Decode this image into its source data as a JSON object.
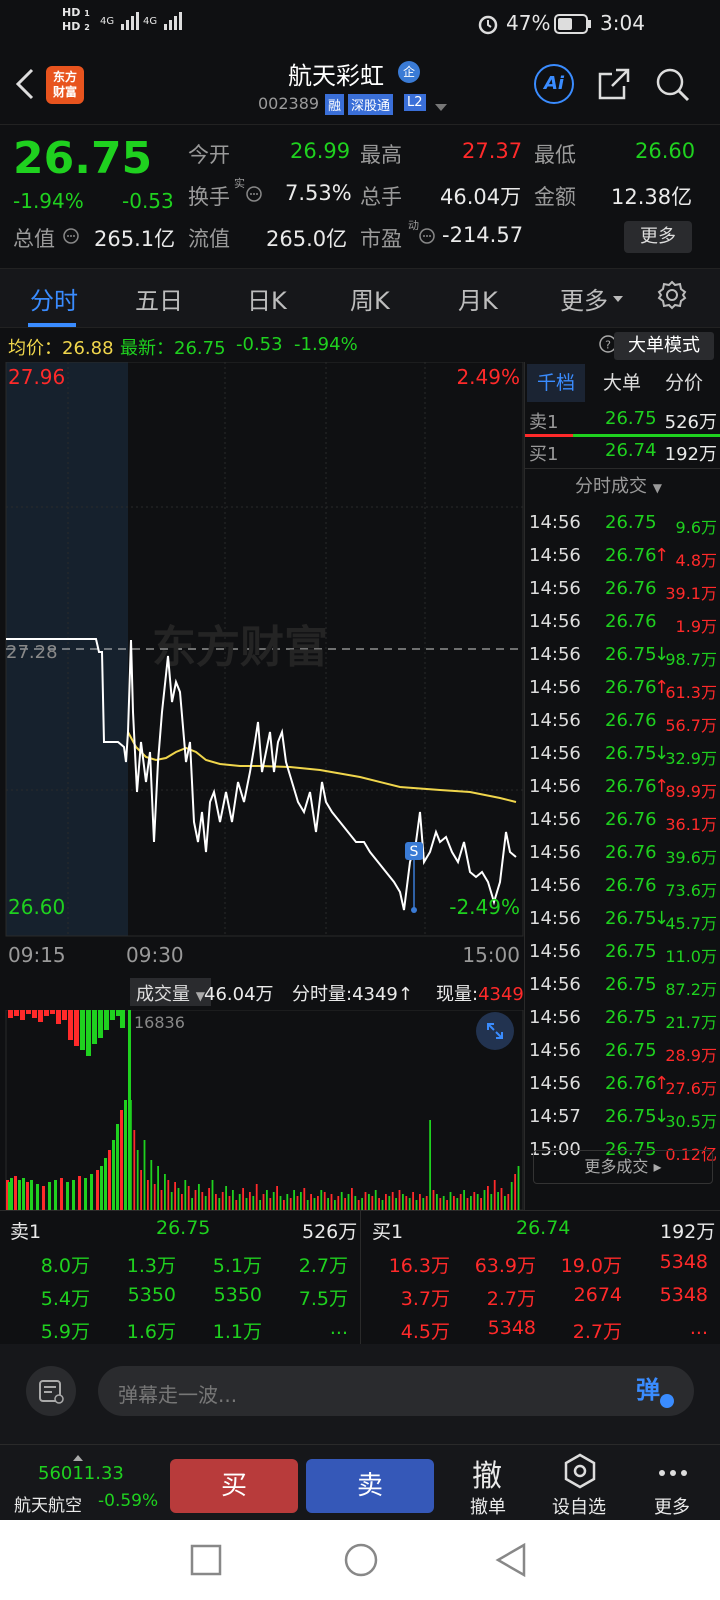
{
  "status_bar": {
    "hd1": "HD",
    "hd2": "HD",
    "net1": "4G",
    "net2": "4G",
    "battery": "47%",
    "time": "3:04"
  },
  "header": {
    "logo_text": "东方财富",
    "title": "航天彩虹",
    "badge_qi": "企",
    "code": "002389",
    "tag_rong": "融",
    "tag_market": "深股通",
    "tag_level": "L2",
    "ai_label": "Ai"
  },
  "quote": {
    "price": "26.75",
    "pct": "-1.94%",
    "chg": "-0.53",
    "open_label": "今开",
    "open": "26.99",
    "high_label": "最高",
    "high": "27.37",
    "low_label": "最低",
    "low": "26.60",
    "turnover_label": "换手",
    "turnover_sup": "实",
    "turnover": "7.53%",
    "volume_label": "总手",
    "volume": "46.04万",
    "amount_label": "金额",
    "amount": "12.38亿",
    "mcap_label": "总值",
    "mcap": "265.1亿",
    "float_label": "流值",
    "float": "265.0亿",
    "pe_label": "市盈",
    "pe_sup": "动",
    "pe": "-214.57",
    "more": "更多"
  },
  "tabs": [
    "分时",
    "五日",
    "日K",
    "周K",
    "月K",
    "更多"
  ],
  "info_line": {
    "avg_label": "均价：",
    "avg": "26.88",
    "latest_label": "最新：",
    "latest": "26.75",
    "chg": "-0.53",
    "pct": "-1.94%",
    "mode_button": "大单模式"
  },
  "chart": {
    "y_top": "27.96",
    "y_bottom": "26.60",
    "pct_top": "2.49%",
    "pct_bottom": "-2.49%",
    "y_mid": "27.28",
    "x_labels": [
      "09:15",
      "09:30",
      "15:00"
    ],
    "watermark": "东方财富",
    "marker": "S"
  },
  "volume_bar": {
    "label": "成交量",
    "total": "46.04万",
    "fs_label": "分时量:",
    "fs": "4349",
    "now_label": "现量:",
    "now": "4349",
    "peak": "16836"
  },
  "right_panel": {
    "tabs": [
      "千档",
      "大单",
      "分价"
    ],
    "sell1": {
      "label": "卖1",
      "price": "26.75",
      "vol": "526万"
    },
    "buy1": {
      "label": "买1",
      "price": "26.74",
      "vol": "192万"
    },
    "trades_title": "分时成交",
    "trades": [
      {
        "t": "14:56",
        "p": "26.75",
        "arrow": "",
        "v": "9.6万",
        "vc": "green"
      },
      {
        "t": "14:56",
        "p": "26.76",
        "arrow": "↑",
        "v": "4.8万",
        "vc": "red"
      },
      {
        "t": "14:56",
        "p": "26.76",
        "arrow": "",
        "v": "39.1万",
        "vc": "red"
      },
      {
        "t": "14:56",
        "p": "26.76",
        "arrow": "",
        "v": "1.9万",
        "vc": "red"
      },
      {
        "t": "14:56",
        "p": "26.75",
        "arrow": "↓",
        "v": "98.7万",
        "vc": "green"
      },
      {
        "t": "14:56",
        "p": "26.76",
        "arrow": "↑",
        "v": "61.3万",
        "vc": "red"
      },
      {
        "t": "14:56",
        "p": "26.76",
        "arrow": "",
        "v": "56.7万",
        "vc": "red"
      },
      {
        "t": "14:56",
        "p": "26.75",
        "arrow": "↓",
        "v": "32.9万",
        "vc": "green"
      },
      {
        "t": "14:56",
        "p": "26.76",
        "arrow": "↑",
        "v": "89.9万",
        "vc": "red"
      },
      {
        "t": "14:56",
        "p": "26.76",
        "arrow": "",
        "v": "36.1万",
        "vc": "red"
      },
      {
        "t": "14:56",
        "p": "26.76",
        "arrow": "",
        "v": "39.6万",
        "vc": "green"
      },
      {
        "t": "14:56",
        "p": "26.76",
        "arrow": "",
        "v": "73.6万",
        "vc": "green"
      },
      {
        "t": "14:56",
        "p": "26.75",
        "arrow": "↓",
        "v": "45.7万",
        "vc": "green"
      },
      {
        "t": "14:56",
        "p": "26.75",
        "arrow": "",
        "v": "11.0万",
        "vc": "green"
      },
      {
        "t": "14:56",
        "p": "26.75",
        "arrow": "",
        "v": "87.2万",
        "vc": "green"
      },
      {
        "t": "14:56",
        "p": "26.75",
        "arrow": "",
        "v": "21.7万",
        "vc": "green"
      },
      {
        "t": "14:56",
        "p": "26.75",
        "arrow": "",
        "v": "28.9万",
        "vc": "red"
      },
      {
        "t": "14:56",
        "p": "26.76",
        "arrow": "↑",
        "v": "27.6万",
        "vc": "red"
      },
      {
        "t": "14:57",
        "p": "26.75",
        "arrow": "↓",
        "v": "30.5万",
        "vc": "green"
      },
      {
        "t": "15:00",
        "p": "26.75",
        "arrow": "",
        "v": "0.12亿",
        "vc": "red"
      }
    ],
    "more_trades": "更多成交"
  },
  "depth": {
    "sell_label": "卖1",
    "sell_price": "26.75",
    "sell_total": "526万",
    "buy_label": "买1",
    "buy_price": "26.74",
    "buy_total": "192万",
    "sell_rows": [
      [
        "8.0万",
        "1.3万",
        "5.1万",
        "2.7万"
      ],
      [
        "5.4万",
        "5350",
        "5350",
        "7.5万"
      ],
      [
        "5.9万",
        "1.6万",
        "1.1万",
        "..."
      ]
    ],
    "buy_rows": [
      [
        "16.3万",
        "63.9万",
        "19.0万",
        "5348"
      ],
      [
        "3.7万",
        "2.7万",
        "2674",
        "5348"
      ],
      [
        "4.5万",
        "5348",
        "2.7万",
        "..."
      ]
    ]
  },
  "danmu": {
    "placeholder": "弹幕走一波...",
    "button": "弹"
  },
  "bottom": {
    "index_value": "56011.33",
    "index_name": "航天航空",
    "index_pct": "-0.59%",
    "buy": "买",
    "sell": "卖",
    "cancel_icon": "撤",
    "cancel": "撤单",
    "watch": "设自选",
    "more": "更多"
  },
  "colors": {
    "up": "#ff2a2a",
    "down": "#1fd11f",
    "avg_line": "#f0d64c",
    "buy_btn": "#b83b3b",
    "sell_btn": "#3558b8",
    "accent": "#3a8cff"
  }
}
